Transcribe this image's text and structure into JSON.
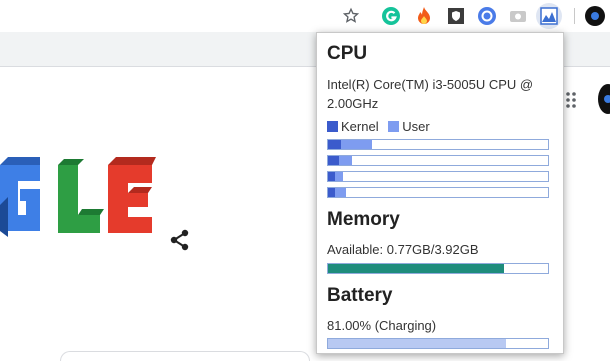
{
  "colors": {
    "kernel": "#3b5bcc",
    "user": "#7e9cf0",
    "memory": "#1e8c7c",
    "battery": "#b8c9f2"
  },
  "toolbar": {
    "icons": [
      "star-icon",
      "grammarly-icon",
      "fire-icon",
      "shield-icon",
      "circle-target-icon",
      "camera-icon",
      "system-monitor-icon",
      "profile-icon"
    ]
  },
  "cpu": {
    "title": "CPU",
    "model": "Intel(R) Core(TM) i3-5005U CPU @ 2.00GHz",
    "legend_kernel": "Kernel",
    "legend_user": "User",
    "cores": [
      {
        "kernel": 0.06,
        "user": 0.14
      },
      {
        "kernel": 0.05,
        "user": 0.06
      },
      {
        "kernel": 0.03,
        "user": 0.04
      },
      {
        "kernel": 0.03,
        "user": 0.05
      }
    ]
  },
  "memory": {
    "title": "Memory",
    "text": "Available: 0.77GB/3.92GB",
    "used_fraction": 0.8
  },
  "battery": {
    "title": "Battery",
    "text": "81.00% (Charging)",
    "level": 0.81
  }
}
